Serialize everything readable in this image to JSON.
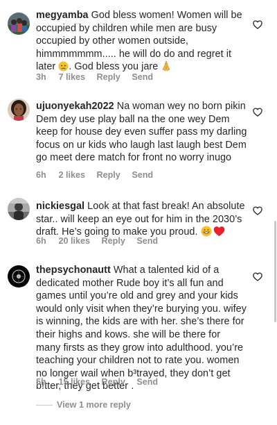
{
  "comments": [
    {
      "username": "megyamba",
      "text_parts": [
        "God bless women! Women will be occupied by children while men are busy occupied by other women outside, himmmmmmm..... he will do do and regret it later ",
        ". God bless you jare "
      ],
      "emojis": [
        "crying-face-emoji",
        "folded-hands-emoji"
      ],
      "time": "3h",
      "likes": "7 likes",
      "reply": "Reply",
      "send": "Send"
    },
    {
      "username": "ujuonyekah2022",
      "text_parts": [
        "Na woman wey no born pikin Dem dey use play ball  na the one wey Dem keep for house dey even suffer pass my darling focus on ur kids who laugh last laugh best Dem go meet dere match for front no worry inugo"
      ],
      "time": "6h",
      "likes": "2 likes",
      "reply": "Reply",
      "send": "Send"
    },
    {
      "username": "nickiesgal",
      "text_parts": [
        "Look at that fast break! An absolute star.. will keep an eye out for him in the 2030’s draft. He’s going to make you proud. "
      ],
      "emojis": [
        "grinning-face-emoji",
        "red-heart-emoji"
      ],
      "time": "6h",
      "likes": "20 likes",
      "reply": "Reply",
      "send": "Send"
    },
    {
      "username": "thepsychonautt",
      "text_parts": [
        "What a talented kid of a dedicated mother  Rude boy it’s all fun and games until you’re old and grey and your kids would only visit when they’re burying you. wifey is winning, the kids are with her. she’s there for their highs and kows. she will be there for many firsts as they grow into adulthood. you’re teaching your children not to rate you. women no longer wail when b³trayed, they don’t get b!tter, they get better ."
      ],
      "time": "5h",
      "likes": "15 likes",
      "reply": "Reply",
      "send": "Send"
    }
  ],
  "view_more": "View 1 more reply",
  "colors": {
    "text": "#262626",
    "meta": "#8e8e8e",
    "heart_outline": "#262626",
    "emoji_heart": "#e8212b",
    "emoji_yellow": "#f7c02d"
  },
  "icons": [
    "heart-outline-icon",
    "avatar"
  ]
}
